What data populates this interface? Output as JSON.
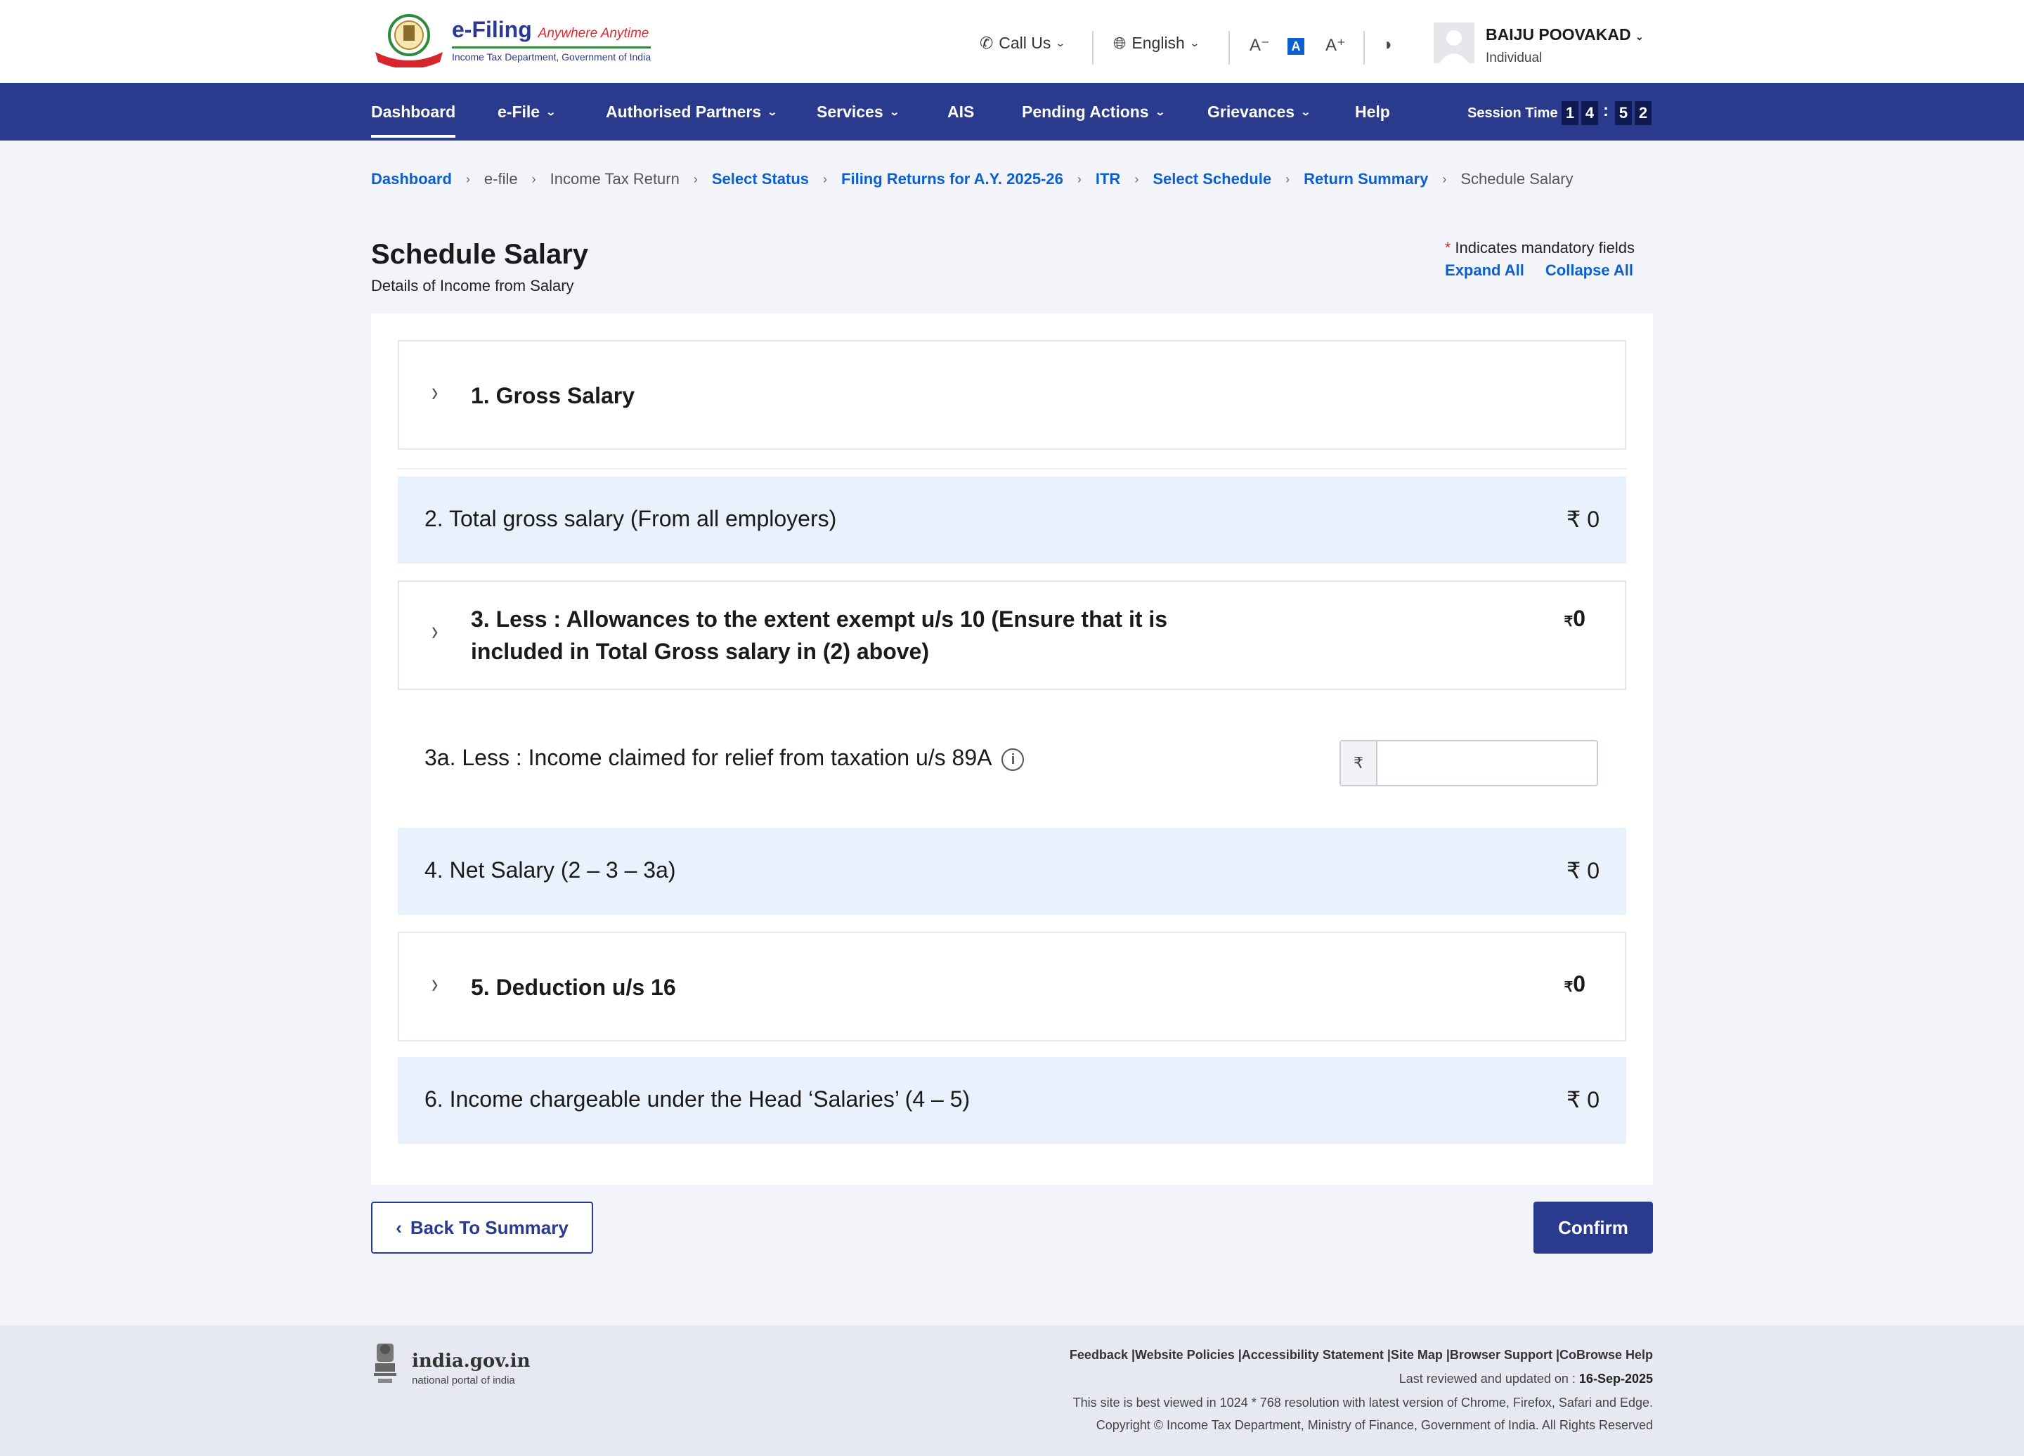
{
  "header": {
    "logo_title": "e-Filing",
    "logo_tagline": "Anywhere Anytime",
    "logo_sub": "Income Tax Department, Government of India",
    "call_us": "Call Us",
    "language": "English",
    "font_decrease": "A⁻",
    "font_normal": "A",
    "font_increase": "A⁺",
    "user_name": "BAIJU POOVAKAD",
    "user_role": "Individual"
  },
  "nav": {
    "items": [
      "Dashboard",
      "e-File",
      "Authorised Partners",
      "Services",
      "AIS",
      "Pending Actions",
      "Grievances",
      "Help"
    ],
    "session_label": "Session Time",
    "session_digits": [
      "1",
      "4",
      "5",
      "2"
    ]
  },
  "breadcrumb": [
    "Dashboard",
    "e-file",
    "Income Tax Return",
    "Select Status",
    "Filing Returns for A.Y. 2025-26",
    "ITR",
    "Select Schedule",
    "Return Summary",
    "Schedule Salary"
  ],
  "page": {
    "title": "Schedule Salary",
    "subtitle": "Details of Income from Salary",
    "mandatory_note": "Indicates mandatory fields",
    "mandatory_star": "*",
    "expand_all": "Expand All",
    "collapse_all": "Collapse All"
  },
  "schedule": {
    "gross_salary": "1. Gross Salary",
    "total_gross": "2. Total gross salary (From all employers)",
    "total_gross_amount": "₹ 0",
    "allowances_line1": "3. Less : Allowances to the extent exempt u/s 10 (Ensure that it is",
    "allowances_line2": "included in Total Gross salary in (2) above)",
    "allowances_rupee": "₹",
    "allowances_amount": "0",
    "relief_label": "3a. Less : Income claimed for relief from taxation u/s 89A",
    "relief_prefix": "₹",
    "relief_value": "",
    "relief_placeholder": "",
    "net_salary": "4. Net Salary (2 – 3 – 3a)",
    "net_salary_amount": "₹ 0",
    "deduction": "5. Deduction u/s 16",
    "deduction_rupee": "₹",
    "deduction_amount": "0",
    "chargeable": "6. Income chargeable under the Head ‘Salaries’ (4 – 5)",
    "chargeable_amount": "₹ 0"
  },
  "actions": {
    "back": "Back To Summary",
    "confirm": "Confirm"
  },
  "footer": {
    "gov_name": "india.gov.in",
    "gov_sub": "national portal of india",
    "links": "Feedback |Website Policies |Accessibility Statement |Site Map |Browser Support |CoBrowse Help",
    "reviewed_label": "Last reviewed and updated on : ",
    "reviewed_date": "16-Sep-2025",
    "best_viewed": "This site is best viewed in 1024 * 768 resolution with latest version of Chrome, Firefox, Safari and Edge.",
    "copyright": "Copyright © Income Tax Department, Ministry of Finance, Government of India. All Rights Reserved"
  },
  "colors": {
    "primary_navy": "#2a3a8c",
    "link_blue": "#0b5fd1",
    "row_shade": "#e9f1fc",
    "accent_red": "#e0272e"
  }
}
